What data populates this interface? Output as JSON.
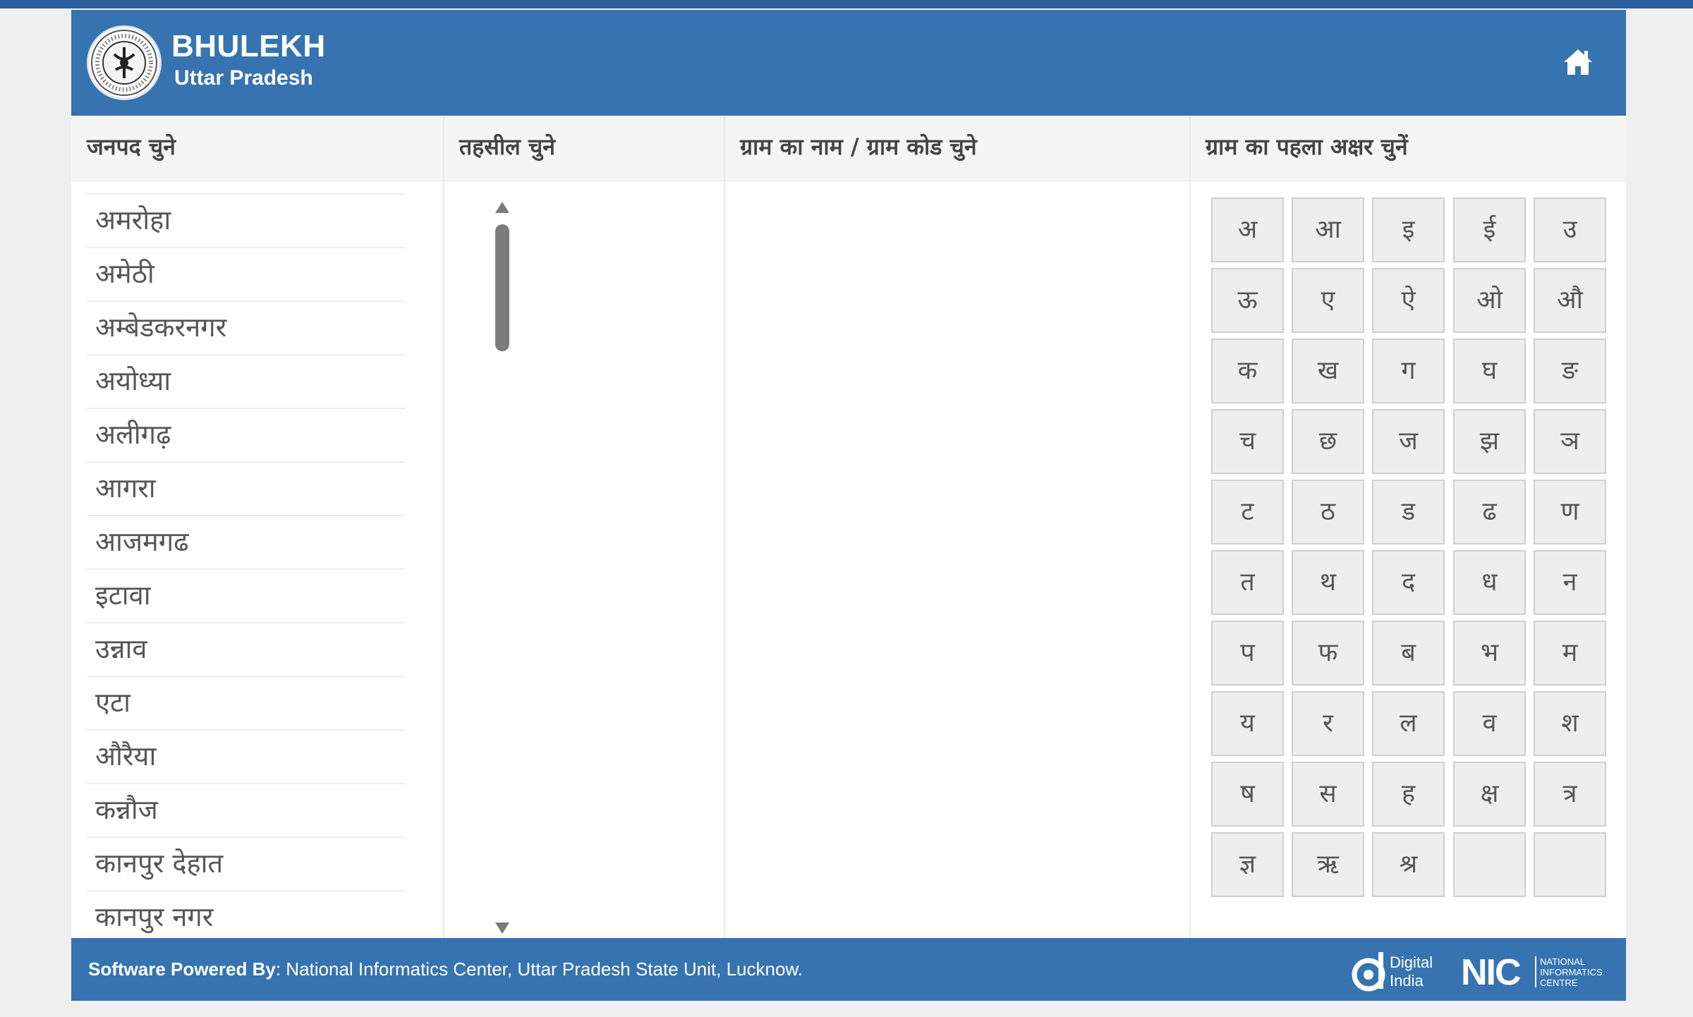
{
  "header": {
    "title": "BHULEKH",
    "subtitle": "Uttar Pradesh",
    "home_icon": "home-icon",
    "brand_color": "#3673b0"
  },
  "columns": {
    "district": "जनपद चुने",
    "tehsil": "तहसील चुने",
    "village": "ग्राम का नाम / ग्राम कोड चुने",
    "first_letter": "ग्राम का पहला अक्षर चुनें"
  },
  "districts": [
    "अमरोहा",
    "अमेठी",
    "अम्बेडकरनगर",
    "अयोध्या",
    "अलीगढ़",
    "आगरा",
    "आजमगढ",
    "इटावा",
    "उन्नाव",
    "एटा",
    "औरैया",
    "कन्नौज",
    "कानपुर देहात",
    "कानपुर नगर"
  ],
  "letters": [
    "अ",
    "आ",
    "इ",
    "ई",
    "उ",
    "ऊ",
    "ए",
    "ऐ",
    "ओ",
    "औ",
    "क",
    "ख",
    "ग",
    "घ",
    "ङ",
    "च",
    "छ",
    "ज",
    "झ",
    "ञ",
    "ट",
    "ठ",
    "ड",
    "ढ",
    "ण",
    "त",
    "थ",
    "द",
    "ध",
    "न",
    "प",
    "फ",
    "ब",
    "भ",
    "म",
    "य",
    "र",
    "ल",
    "व",
    "श",
    "ष",
    "स",
    "ह",
    "क्ष",
    "त्र",
    "ज्ञ",
    "ऋ",
    "श्र",
    "",
    ""
  ],
  "footer": {
    "powered_label": "Software Powered By",
    "powered_text": ": National Informatics Center, Uttar Pradesh State Unit, Lucknow.",
    "digital_india_line1": "Digital",
    "digital_india_line2": "India",
    "nic_short": "NIC",
    "nic_line1": "NATIONAL",
    "nic_line2": "INFORMATICS",
    "nic_line3": "CENTRE"
  }
}
